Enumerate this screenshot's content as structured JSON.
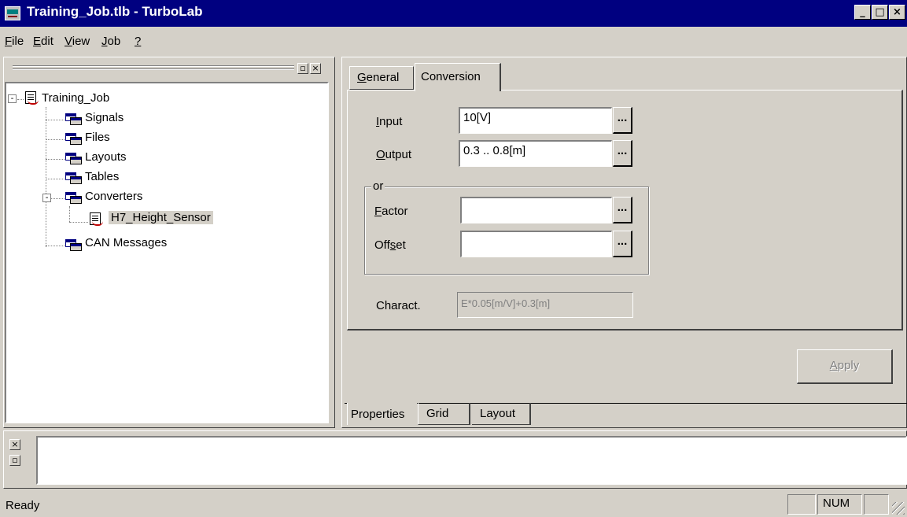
{
  "window": {
    "title": "Training_Job.tlb - TurboLab",
    "minimize_glyph": "_",
    "maximize_glyph": "□",
    "close_glyph": "×"
  },
  "menu": [
    {
      "label": "File",
      "mnemonic": "F",
      "rest": "ile"
    },
    {
      "label": "Edit",
      "mnemonic": "E",
      "rest": "dit"
    },
    {
      "label": "View",
      "mnemonic": "V",
      "rest": "iew"
    },
    {
      "label": "Job",
      "mnemonic": "J",
      "rest": "ob"
    },
    {
      "label": "?",
      "mnemonic": "?",
      "rest": ""
    }
  ],
  "tree": {
    "root": "Training_Job",
    "items": [
      "Signals",
      "Files",
      "Layouts",
      "Tables",
      "Converters",
      "H7_Height_Sensor",
      "CAN Messages"
    ]
  },
  "props": {
    "tabs": [
      {
        "label": "General",
        "mnemonic": "G",
        "rest": "eneral"
      },
      {
        "label": "Conversion",
        "mnemonic": "",
        "rest": "Conversion"
      }
    ],
    "input_label": {
      "mnemonic": "I",
      "rest": "nput"
    },
    "input_value": "10[V]",
    "output_label": {
      "mnemonic": "O",
      "rest": "utput"
    },
    "output_value": "0.3 .. 0.8[m]",
    "or_label": "or",
    "factor_label": {
      "mnemonic": "F",
      "rest": "actor"
    },
    "factor_value": "",
    "offset_label": {
      "pre": "Off",
      "mnemonic": "s",
      "rest": "et"
    },
    "offset_value": "",
    "charact_label": "Charact.",
    "charact_value": "E*0.05[m/V]+0.3[m]",
    "ellipsis": "...",
    "apply_label": {
      "mnemonic": "A",
      "rest": "pply"
    }
  },
  "bottom_tabs": [
    "Properties",
    "Grid",
    "Layout"
  ],
  "status": {
    "text": "Ready",
    "num": "NUM"
  }
}
